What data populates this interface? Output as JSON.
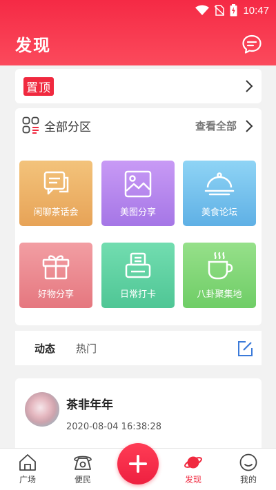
{
  "status_bar": {
    "time": "10:47"
  },
  "header": {
    "title": "发现"
  },
  "pinned": {
    "badge": "置顶"
  },
  "categories": {
    "title": "全部分区",
    "more_label": "查看全部",
    "items": [
      {
        "label": "闲聊茶话会",
        "icon": "chat-bubbles-icon",
        "color": "#efb469"
      },
      {
        "label": "美图分享",
        "icon": "image-icon",
        "color": "#b787ee"
      },
      {
        "label": "美食论坛",
        "icon": "food-cloche-icon",
        "color": "#78c2f0"
      },
      {
        "label": "好物分享",
        "icon": "gift-icon",
        "color": "#ee8e94"
      },
      {
        "label": "日常打卡",
        "icon": "check-in-icon",
        "color": "#62d3a4"
      },
      {
        "label": "八卦聚集地",
        "icon": "coffee-cup-icon",
        "color": "#82d778"
      }
    ]
  },
  "tabs": [
    {
      "label": "动态",
      "active": true
    },
    {
      "label": "热门",
      "active": false
    }
  ],
  "post": {
    "user": "茶非年年",
    "time": "2020-08-04 16:38:28"
  },
  "bottom_nav": [
    {
      "label": "广场",
      "icon": "home-icon",
      "active": false
    },
    {
      "label": "便民",
      "icon": "telephone-icon",
      "active": false
    },
    {
      "label": "发现",
      "icon": "planet-icon",
      "active": true
    },
    {
      "label": "我的",
      "icon": "user-smile-icon",
      "active": false
    }
  ],
  "colors": {
    "accent": "#f0293f"
  }
}
